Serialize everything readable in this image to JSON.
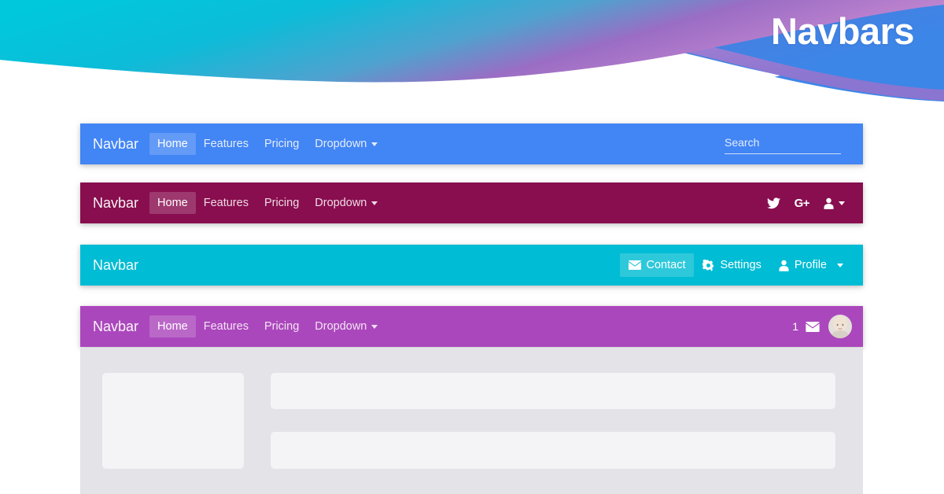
{
  "hero": {
    "title": "Navbars",
    "wave_colors": {
      "cyan": "#00c3d9",
      "teal_mid": "#2aa9cf",
      "purple": "#9b59c6",
      "orchid": "#c77fd0",
      "blue": "#3b82e0",
      "indigo": "#5a62c8",
      "background": "#ffffff"
    }
  },
  "navbars": [
    {
      "id": "navbar-blue",
      "color": "#4285f4",
      "brand": "Navbar",
      "links": [
        {
          "label": "Home",
          "active": true,
          "dropdown": false
        },
        {
          "label": "Features",
          "active": false,
          "dropdown": false
        },
        {
          "label": "Pricing",
          "active": false,
          "dropdown": false
        },
        {
          "label": "Dropdown",
          "active": false,
          "dropdown": true
        }
      ],
      "search": {
        "placeholder": "Search",
        "value": ""
      }
    },
    {
      "id": "navbar-maroon",
      "color": "#880e4f",
      "brand": "Navbar",
      "links": [
        {
          "label": "Home",
          "active": true,
          "dropdown": false
        },
        {
          "label": "Features",
          "active": false,
          "dropdown": false
        },
        {
          "label": "Pricing",
          "active": false,
          "dropdown": false
        },
        {
          "label": "Dropdown",
          "active": false,
          "dropdown": true
        }
      ],
      "icons": [
        {
          "name": "twitter-icon",
          "glyph": ""
        },
        {
          "name": "google-plus-icon",
          "glyph": "G+"
        },
        {
          "name": "user-icon",
          "glyph": ""
        }
      ]
    },
    {
      "id": "navbar-cyan",
      "color": "#00bcd4",
      "brand": "Navbar",
      "actions": [
        {
          "label": "Contact",
          "icon": "envelope-icon",
          "active": true,
          "dropdown": false
        },
        {
          "label": "Settings",
          "icon": "gear-icon",
          "active": false,
          "dropdown": false
        },
        {
          "label": "Profile",
          "icon": "user-icon",
          "active": false,
          "dropdown": true
        }
      ]
    },
    {
      "id": "navbar-purple",
      "color": "#ab47bc",
      "brand": "Navbar",
      "links": [
        {
          "label": "Home",
          "active": true,
          "dropdown": false
        },
        {
          "label": "Features",
          "active": false,
          "dropdown": false
        },
        {
          "label": "Pricing",
          "active": false,
          "dropdown": false
        },
        {
          "label": "Dropdown",
          "active": false,
          "dropdown": true
        }
      ],
      "message_count": "1"
    }
  ],
  "content": {
    "background": "#e3e3e8",
    "placeholder_color": "#f4f4f6",
    "blocks": [
      {
        "name": "skeleton-block-left"
      },
      {
        "name": "skeleton-block-top"
      },
      {
        "name": "skeleton-block-bottom"
      }
    ]
  }
}
